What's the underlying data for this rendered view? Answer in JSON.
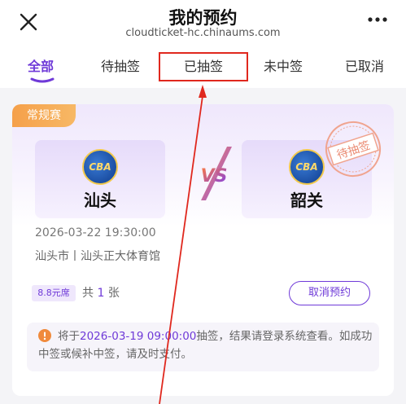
{
  "header": {
    "title": "我的预约",
    "url": "cloudticket-hc.chinaums.com"
  },
  "tabs": [
    {
      "label": "全部",
      "active": true
    },
    {
      "label": "待抽签",
      "active": false
    },
    {
      "label": "已抽签",
      "active": false,
      "highlighted": true
    },
    {
      "label": "未中签",
      "active": false
    },
    {
      "label": "已取消",
      "active": false
    }
  ],
  "card": {
    "badge": "常规赛",
    "status_stamp": "待抽签",
    "team_home": {
      "name": "汕头",
      "logo_text": "CBA"
    },
    "team_away": {
      "name": "韶关",
      "logo_text": "CBA"
    },
    "vs_text": "VS",
    "datetime": "2026-03-22 19:30:00",
    "venue": "汕头市丨汕头正大体育馆",
    "price_tag": "8.8元席",
    "qty_prefix": "共",
    "qty_value": "1",
    "qty_suffix": "张",
    "cancel_button": "取消预约",
    "notice_prefix": "将于",
    "notice_time": "2026-03-19 09:00:00",
    "notice_suffix": "抽签，结果请登录系统查看。如成功中签或候补中签，请及时支付。"
  },
  "colors": {
    "accent": "#6f3ad8",
    "badge_orange": "#f5a04a",
    "annotation_red": "#e0281e"
  }
}
